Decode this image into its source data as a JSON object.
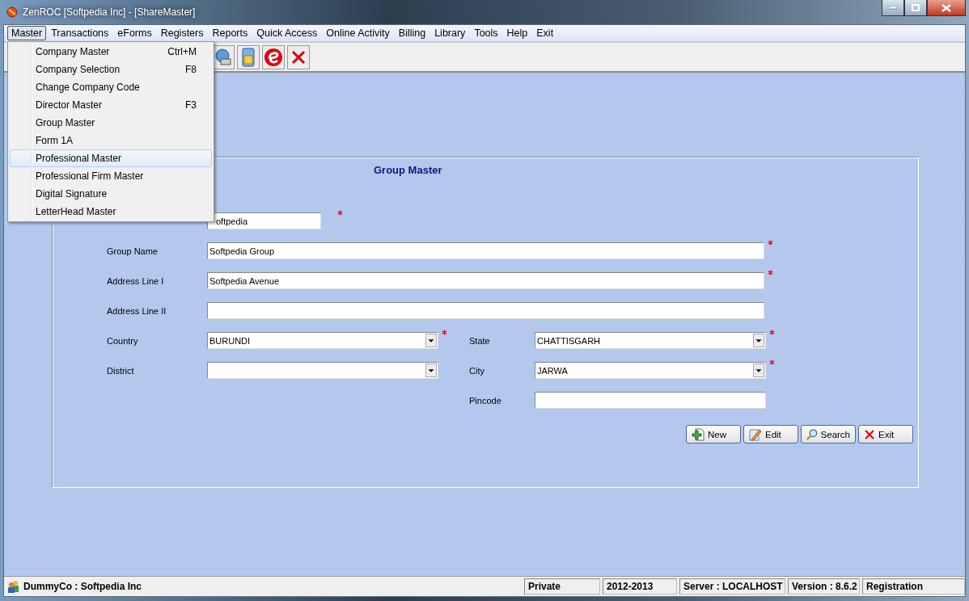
{
  "window": {
    "title": "ZenROC [Softpedia Inc] - [ShareMaster]"
  },
  "menu_bar": [
    {
      "label": "Master",
      "selected": true
    },
    {
      "label": "Transactions",
      "selected": false
    },
    {
      "label": "eForms",
      "selected": false
    },
    {
      "label": "Registers",
      "selected": false
    },
    {
      "label": "Reports",
      "selected": false
    },
    {
      "label": "Quick Access",
      "selected": false
    },
    {
      "label": "Online Activity",
      "selected": false
    },
    {
      "label": "Billing",
      "selected": false
    },
    {
      "label": "Library",
      "selected": false
    },
    {
      "label": "Tools",
      "selected": false
    },
    {
      "label": "Help",
      "selected": false
    },
    {
      "label": "Exit",
      "selected": false
    }
  ],
  "dropdown_menu": [
    {
      "label": "Company Master",
      "shortcut": "Ctrl+M",
      "selected": false
    },
    {
      "label": "Company Selection",
      "shortcut": "F8",
      "selected": false
    },
    {
      "label": "Change Company Code",
      "selected": false
    },
    {
      "label": "Director Master",
      "shortcut": "F3",
      "selected": false
    },
    {
      "label": "Group Master",
      "selected": false
    },
    {
      "label": "Form 1A",
      "selected": false
    },
    {
      "label": "Professional Master",
      "selected": true
    },
    {
      "label": "Professional Firm Master",
      "selected": false
    },
    {
      "label": "Digital Signature",
      "selected": false
    },
    {
      "label": "LetterHead Master",
      "selected": false
    }
  ],
  "toolbar": [
    {
      "kind": "network"
    },
    {
      "kind": "calculator"
    },
    {
      "kind": "e"
    },
    {
      "kind": "close"
    }
  ],
  "form": {
    "title": "Group Master",
    "company_field": {
      "value": "oftpedia",
      "required": true
    },
    "rows": [
      [
        {
          "label": "Group Name",
          "kind": "text",
          "value": "Softpedia Group",
          "required": true
        }
      ],
      [
        {
          "label": "Address Line I",
          "kind": "text",
          "value": "Softpedia Avenue",
          "required": true
        }
      ],
      [
        {
          "label": "Address Line II",
          "kind": "text",
          "required": false
        }
      ],
      [
        {
          "label": "Country",
          "kind": "select",
          "value": "BURUNDI",
          "required": true
        },
        {
          "label": "State",
          "kind": "select",
          "value": "CHATTISGARH",
          "required": true
        }
      ],
      [
        {
          "label": "District",
          "kind": "select",
          "required": false
        },
        {
          "label": "City",
          "kind": "select",
          "value": "JARWA",
          "required": true
        }
      ],
      [
        {
          "kind": "empty"
        },
        {
          "label": "Pincode",
          "kind": "text",
          "required": false
        }
      ]
    ],
    "buttons": [
      {
        "label": "New",
        "kind": "new"
      },
      {
        "label": "Edit",
        "kind": "edit"
      },
      {
        "label": "Search",
        "kind": "search"
      },
      {
        "label": "Exit",
        "kind": "exit"
      }
    ]
  },
  "status_bar": {
    "company": "DummyCo : Softpedia Inc",
    "cells": [
      "Private",
      "2012-2013",
      "Server : LOCALHOST",
      "Version : 8.6.2",
      "Registration"
    ]
  }
}
